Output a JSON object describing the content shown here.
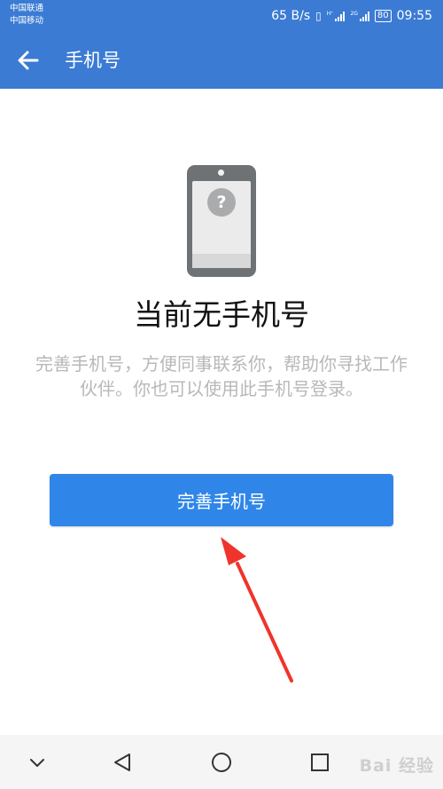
{
  "status_bar": {
    "carrier_1": "中国联通",
    "carrier_2": "中国移动",
    "net_speed": "65 B/s",
    "sim1_type": "H⁺",
    "sim2_type": "2G",
    "battery": "80",
    "time": "09:55"
  },
  "app_bar": {
    "title": "手机号",
    "back_icon": "arrow-left-icon"
  },
  "content": {
    "illustration_icon": "phone-question-icon",
    "title": "当前无手机号",
    "description": "完善手机号，方便同事联系你，帮助你寻找工作伙伴。你也可以使用此手机号登录。",
    "button_label": "完善手机号"
  },
  "nav_bar": {
    "icons": [
      "chevron-down-icon",
      "triangle-back-icon",
      "circle-home-icon",
      "square-recent-icon"
    ],
    "watermark": "Bai 经验"
  },
  "colors": {
    "app_bar": "#3b7bd4",
    "button": "#2f86e8",
    "annotation_arrow": "#f0342c",
    "description_text": "#b8b8b8"
  }
}
